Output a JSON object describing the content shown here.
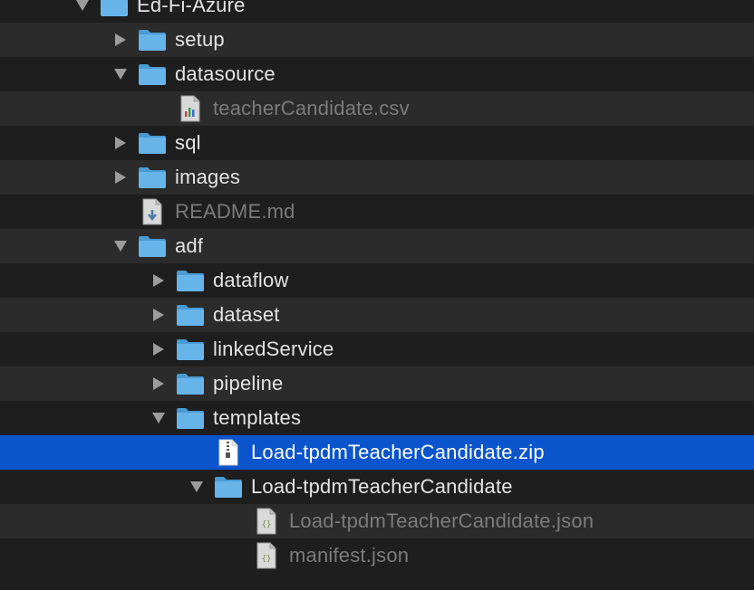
{
  "tree": {
    "items": [
      {
        "label": "Ed-Fi-Azure",
        "state": "expanded",
        "kind": "folder",
        "depth": 0,
        "dim": false,
        "icon": "folder-icon"
      },
      {
        "label": "setup",
        "state": "collapsed",
        "kind": "folder",
        "depth": 1,
        "dim": false,
        "icon": "folder-icon"
      },
      {
        "label": "datasource",
        "state": "expanded",
        "kind": "folder",
        "depth": 1,
        "dim": false,
        "icon": "folder-icon"
      },
      {
        "label": "teacherCandidate.csv",
        "state": "leaf",
        "kind": "csv",
        "depth": 2,
        "dim": true,
        "icon": "csv-file-icon"
      },
      {
        "label": "sql",
        "state": "collapsed",
        "kind": "folder",
        "depth": 1,
        "dim": false,
        "icon": "folder-icon"
      },
      {
        "label": "images",
        "state": "collapsed",
        "kind": "folder",
        "depth": 1,
        "dim": false,
        "icon": "folder-icon"
      },
      {
        "label": "README.md",
        "state": "leaf",
        "kind": "markdown",
        "depth": 1,
        "dim": true,
        "icon": "markdown-file-icon"
      },
      {
        "label": "adf",
        "state": "expanded",
        "kind": "folder",
        "depth": 1,
        "dim": false,
        "icon": "folder-icon"
      },
      {
        "label": "dataflow",
        "state": "collapsed",
        "kind": "folder",
        "depth": 2,
        "dim": false,
        "icon": "folder-icon"
      },
      {
        "label": "dataset",
        "state": "collapsed",
        "kind": "folder",
        "depth": 2,
        "dim": false,
        "icon": "folder-icon"
      },
      {
        "label": "linkedService",
        "state": "collapsed",
        "kind": "folder",
        "depth": 2,
        "dim": false,
        "icon": "folder-icon"
      },
      {
        "label": "pipeline",
        "state": "collapsed",
        "kind": "folder",
        "depth": 2,
        "dim": false,
        "icon": "folder-icon"
      },
      {
        "label": "templates",
        "state": "expanded",
        "kind": "folder",
        "depth": 2,
        "dim": false,
        "icon": "folder-icon"
      },
      {
        "label": "Load-tpdmTeacherCandidate.zip",
        "state": "leaf",
        "kind": "zip",
        "depth": 3,
        "dim": false,
        "icon": "zip-file-icon",
        "selected": true
      },
      {
        "label": "Load-tpdmTeacherCandidate",
        "state": "expanded",
        "kind": "folder",
        "depth": 3,
        "dim": false,
        "icon": "folder-icon"
      },
      {
        "label": "Load-tpdmTeacherCandidate.json",
        "state": "leaf",
        "kind": "json",
        "depth": 4,
        "dim": true,
        "icon": "json-file-icon"
      },
      {
        "label": "manifest.json",
        "state": "leaf",
        "kind": "json",
        "depth": 4,
        "dim": true,
        "icon": "json-file-icon"
      }
    ]
  },
  "colors": {
    "background_odd": "#1e1e1e",
    "background_even": "#2b2b2b",
    "selection": "#0b55cc",
    "folder": "#5fb0e6",
    "text": "#e4e4e4",
    "text_dim": "#7b7b7b"
  }
}
